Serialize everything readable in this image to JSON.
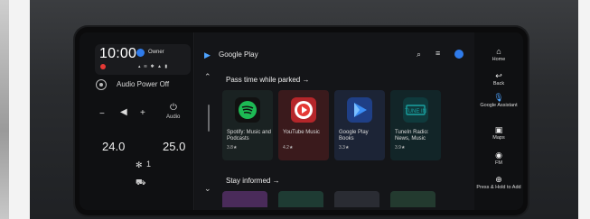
{
  "status": {
    "time": "10:00",
    "user": "Owner"
  },
  "climate": {
    "audio_power": "Audio Power Off",
    "audio_label": "Audio",
    "temp_left": "24.0",
    "temp_right": "25.0",
    "fan_speed": "1"
  },
  "main": {
    "app_title": "Google Play",
    "section1": "Pass time while parked",
    "section2": "Stay informed",
    "apps": [
      {
        "name": "Spotify: Music and Podcasts",
        "rating": "3.8★",
        "color": "#1db954"
      },
      {
        "name": "YouTube Music",
        "rating": "4.2★",
        "color": "#e53935"
      },
      {
        "name": "Google Play Books",
        "rating": "3.3★",
        "color": "#2f80ed"
      },
      {
        "name": "TuneIn Radio: News, Music",
        "rating": "3.9★",
        "color": "#1aa1a1"
      }
    ]
  },
  "rail": {
    "items": [
      {
        "icon": "home-icon",
        "label": "Home"
      },
      {
        "icon": "back-icon",
        "label": "Back"
      },
      {
        "icon": "mic-icon",
        "label": "Google Assistant"
      },
      {
        "icon": "map-icon",
        "label": "Maps"
      },
      {
        "icon": "radio-icon",
        "label": "FM"
      },
      {
        "icon": "add-icon",
        "label": "Press & Hold to Add"
      }
    ]
  }
}
